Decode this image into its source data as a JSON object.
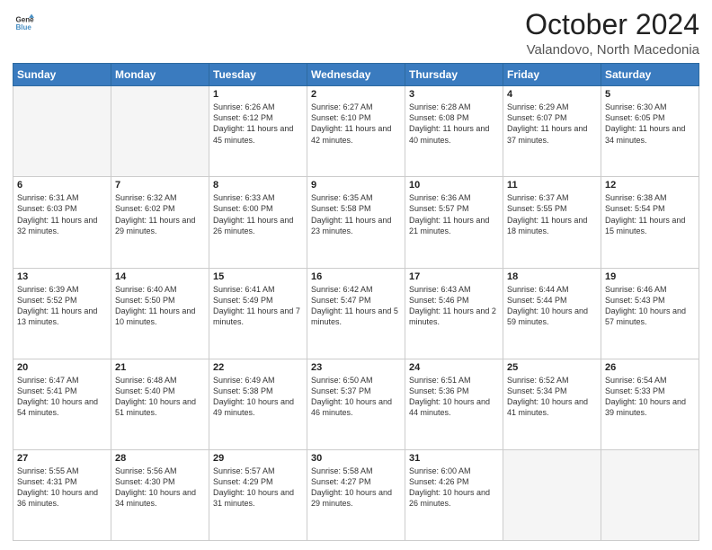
{
  "header": {
    "logo_line1": "General",
    "logo_line2": "Blue",
    "title": "October 2024",
    "subtitle": "Valandovo, North Macedonia"
  },
  "days_of_week": [
    "Sunday",
    "Monday",
    "Tuesday",
    "Wednesday",
    "Thursday",
    "Friday",
    "Saturday"
  ],
  "weeks": [
    [
      {
        "day": "",
        "info": ""
      },
      {
        "day": "",
        "info": ""
      },
      {
        "day": "1",
        "info": "Sunrise: 6:26 AM\nSunset: 6:12 PM\nDaylight: 11 hours and 45 minutes."
      },
      {
        "day": "2",
        "info": "Sunrise: 6:27 AM\nSunset: 6:10 PM\nDaylight: 11 hours and 42 minutes."
      },
      {
        "day": "3",
        "info": "Sunrise: 6:28 AM\nSunset: 6:08 PM\nDaylight: 11 hours and 40 minutes."
      },
      {
        "day": "4",
        "info": "Sunrise: 6:29 AM\nSunset: 6:07 PM\nDaylight: 11 hours and 37 minutes."
      },
      {
        "day": "5",
        "info": "Sunrise: 6:30 AM\nSunset: 6:05 PM\nDaylight: 11 hours and 34 minutes."
      }
    ],
    [
      {
        "day": "6",
        "info": "Sunrise: 6:31 AM\nSunset: 6:03 PM\nDaylight: 11 hours and 32 minutes."
      },
      {
        "day": "7",
        "info": "Sunrise: 6:32 AM\nSunset: 6:02 PM\nDaylight: 11 hours and 29 minutes."
      },
      {
        "day": "8",
        "info": "Sunrise: 6:33 AM\nSunset: 6:00 PM\nDaylight: 11 hours and 26 minutes."
      },
      {
        "day": "9",
        "info": "Sunrise: 6:35 AM\nSunset: 5:58 PM\nDaylight: 11 hours and 23 minutes."
      },
      {
        "day": "10",
        "info": "Sunrise: 6:36 AM\nSunset: 5:57 PM\nDaylight: 11 hours and 21 minutes."
      },
      {
        "day": "11",
        "info": "Sunrise: 6:37 AM\nSunset: 5:55 PM\nDaylight: 11 hours and 18 minutes."
      },
      {
        "day": "12",
        "info": "Sunrise: 6:38 AM\nSunset: 5:54 PM\nDaylight: 11 hours and 15 minutes."
      }
    ],
    [
      {
        "day": "13",
        "info": "Sunrise: 6:39 AM\nSunset: 5:52 PM\nDaylight: 11 hours and 13 minutes."
      },
      {
        "day": "14",
        "info": "Sunrise: 6:40 AM\nSunset: 5:50 PM\nDaylight: 11 hours and 10 minutes."
      },
      {
        "day": "15",
        "info": "Sunrise: 6:41 AM\nSunset: 5:49 PM\nDaylight: 11 hours and 7 minutes."
      },
      {
        "day": "16",
        "info": "Sunrise: 6:42 AM\nSunset: 5:47 PM\nDaylight: 11 hours and 5 minutes."
      },
      {
        "day": "17",
        "info": "Sunrise: 6:43 AM\nSunset: 5:46 PM\nDaylight: 11 hours and 2 minutes."
      },
      {
        "day": "18",
        "info": "Sunrise: 6:44 AM\nSunset: 5:44 PM\nDaylight: 10 hours and 59 minutes."
      },
      {
        "day": "19",
        "info": "Sunrise: 6:46 AM\nSunset: 5:43 PM\nDaylight: 10 hours and 57 minutes."
      }
    ],
    [
      {
        "day": "20",
        "info": "Sunrise: 6:47 AM\nSunset: 5:41 PM\nDaylight: 10 hours and 54 minutes."
      },
      {
        "day": "21",
        "info": "Sunrise: 6:48 AM\nSunset: 5:40 PM\nDaylight: 10 hours and 51 minutes."
      },
      {
        "day": "22",
        "info": "Sunrise: 6:49 AM\nSunset: 5:38 PM\nDaylight: 10 hours and 49 minutes."
      },
      {
        "day": "23",
        "info": "Sunrise: 6:50 AM\nSunset: 5:37 PM\nDaylight: 10 hours and 46 minutes."
      },
      {
        "day": "24",
        "info": "Sunrise: 6:51 AM\nSunset: 5:36 PM\nDaylight: 10 hours and 44 minutes."
      },
      {
        "day": "25",
        "info": "Sunrise: 6:52 AM\nSunset: 5:34 PM\nDaylight: 10 hours and 41 minutes."
      },
      {
        "day": "26",
        "info": "Sunrise: 6:54 AM\nSunset: 5:33 PM\nDaylight: 10 hours and 39 minutes."
      }
    ],
    [
      {
        "day": "27",
        "info": "Sunrise: 5:55 AM\nSunset: 4:31 PM\nDaylight: 10 hours and 36 minutes."
      },
      {
        "day": "28",
        "info": "Sunrise: 5:56 AM\nSunset: 4:30 PM\nDaylight: 10 hours and 34 minutes."
      },
      {
        "day": "29",
        "info": "Sunrise: 5:57 AM\nSunset: 4:29 PM\nDaylight: 10 hours and 31 minutes."
      },
      {
        "day": "30",
        "info": "Sunrise: 5:58 AM\nSunset: 4:27 PM\nDaylight: 10 hours and 29 minutes."
      },
      {
        "day": "31",
        "info": "Sunrise: 6:00 AM\nSunset: 4:26 PM\nDaylight: 10 hours and 26 minutes."
      },
      {
        "day": "",
        "info": ""
      },
      {
        "day": "",
        "info": ""
      }
    ]
  ]
}
